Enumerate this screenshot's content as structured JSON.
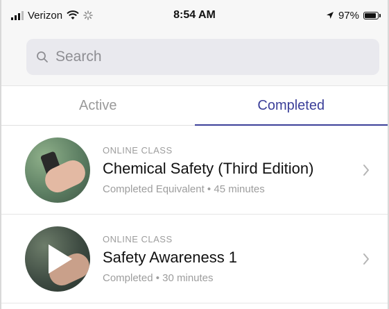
{
  "status_bar": {
    "carrier": "Verizon",
    "time": "8:54 AM",
    "battery_percent": "97%",
    "battery_level": 0.97
  },
  "search": {
    "placeholder": "Search",
    "value": ""
  },
  "tabs": [
    {
      "label": "Active",
      "active": false
    },
    {
      "label": "Completed",
      "active": true
    }
  ],
  "classes": [
    {
      "category": "ONLINE CLASS",
      "title": "Chemical Safety (Third Edition)",
      "status": "Completed Equivalent",
      "duration": "45 minutes",
      "thumbnail_icon": "hand-phone-photo"
    },
    {
      "category": "ONLINE CLASS",
      "title": "Safety Awareness 1",
      "status": "Completed",
      "duration": "30 minutes",
      "thumbnail_icon": "play-video-photo"
    }
  ],
  "colors": {
    "accent": "#3b3f99",
    "muted_text": "#9d9d9d",
    "search_bg": "#e9e9ee"
  }
}
